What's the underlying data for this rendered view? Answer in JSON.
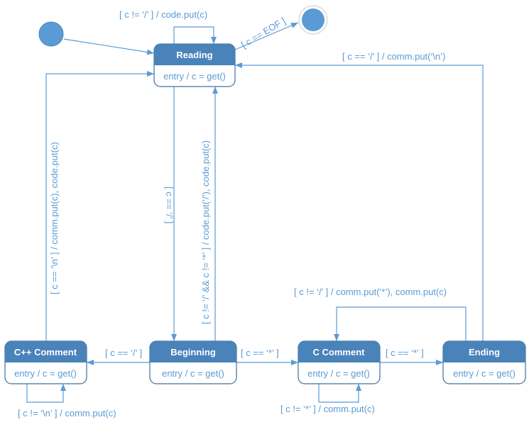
{
  "colors": {
    "state_header": "#4a82ba",
    "line": "#5b9bd5",
    "text": "#5b9bd5",
    "node": "#5b9bd5"
  },
  "states": [
    {
      "name": "Reading",
      "entry": "entry / c = get()"
    },
    {
      "name": "C++ Comment",
      "entry": "entry / c = get()"
    },
    {
      "name": "Beginning",
      "entry": "entry / c = get()"
    },
    {
      "name": "C Comment",
      "entry": "entry / c = get()"
    },
    {
      "name": "Ending",
      "entry": "entry / c = get()"
    }
  ],
  "transitions": {
    "reading_self": "[ c != ‘/’ ] / code.put(c)",
    "reading_final": "[ c == EOF ]",
    "ending_reading": "[ c == ‘/’ ]  / comm.put(‘\\n’)",
    "cpp_reading": "[ c == ‘\\n’ ] / comm.put(c), code.put(c)",
    "reading_beginning": "[ c == ‘/’ ]",
    "beginning_reading": "[ c != ‘/’ && c != ‘*’ ] / code.put(‘/’), code.put(c)",
    "beginning_cpp": "[ c == ‘/’ ]",
    "beginning_ccomment": "[ c == ‘*’ ]",
    "ccomment_ending": "[ c == ‘*’ ]",
    "ending_ccomment": "[ c != ‘/’ ] / comm.put(‘*’), comm.put(c)",
    "cpp_self": "[ c != ‘\\n’ ] / comm.put(c)",
    "ccomment_self": "[ c != ‘*’ ] / comm.put(c)"
  }
}
